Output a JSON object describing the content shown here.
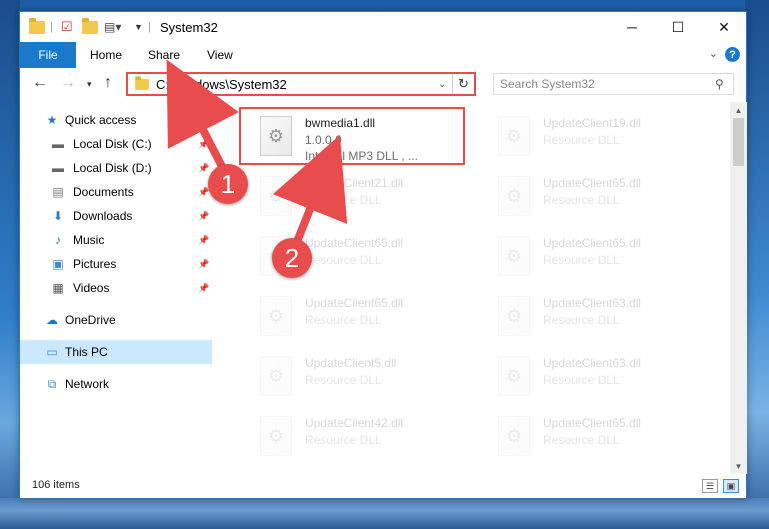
{
  "window": {
    "title": "System32",
    "controls": {
      "minimize": "─",
      "maximize": "☐",
      "close": "✕"
    }
  },
  "ribbon": {
    "file": "File",
    "tabs": [
      "Home",
      "Share",
      "View"
    ],
    "help": "?"
  },
  "address": {
    "path": "C:\\Windows\\System32",
    "search_placeholder": "Search System32"
  },
  "nav": {
    "items": [
      {
        "label": "Quick access",
        "icon": "star-icon",
        "glyph": "★",
        "color": "#2b78c5",
        "pinned": false,
        "indent": 0
      },
      {
        "label": "Local Disk (C:)",
        "icon": "drive-icon",
        "glyph": "▬",
        "color": "#666666",
        "pinned": true,
        "indent": 1
      },
      {
        "label": "Local Disk (D:)",
        "icon": "drive-icon",
        "glyph": "▬",
        "color": "#666666",
        "pinned": true,
        "indent": 1
      },
      {
        "label": "Documents",
        "icon": "documents-icon",
        "glyph": "▤",
        "color": "#777777",
        "pinned": true,
        "indent": 1
      },
      {
        "label": "Downloads",
        "icon": "downloads-icon",
        "glyph": "⬇",
        "color": "#2b78c5",
        "pinned": true,
        "indent": 1
      },
      {
        "label": "Music",
        "icon": "music-icon",
        "glyph": "♪",
        "color": "#2b78c5",
        "pinned": true,
        "indent": 1
      },
      {
        "label": "Pictures",
        "icon": "pictures-icon",
        "glyph": "▣",
        "color": "#3b8ad0",
        "pinned": true,
        "indent": 1
      },
      {
        "label": "Videos",
        "icon": "videos-icon",
        "glyph": "▦",
        "color": "#555555",
        "pinned": true,
        "indent": 1
      },
      {
        "label": "OneDrive",
        "icon": "cloud-icon",
        "glyph": "☁",
        "color": "#1979ca",
        "pinned": false,
        "indent": 0
      },
      {
        "label": "This PC",
        "icon": "computer-icon",
        "glyph": "▭",
        "color": "#3d8ee0",
        "pinned": false,
        "indent": 0,
        "selected": true
      },
      {
        "label": "Network",
        "icon": "network-icon",
        "glyph": "⧉",
        "color": "#3d8ee0",
        "pinned": false,
        "indent": 0
      }
    ]
  },
  "files": [
    {
      "name": "bwmedia1.dll",
      "line1": "1.0.0.0",
      "line2": "Internal MP3 DLL , ...",
      "faded": false
    },
    {
      "name": "UpdateClient19.dll",
      "line1": "Resource DLL",
      "line2": "",
      "faded": true
    },
    {
      "name": "UpdateClient21.dll",
      "line1": "Resource DLL",
      "line2": "",
      "faded": true
    },
    {
      "name": "UpdateClient65.dll",
      "line1": "Resource DLL",
      "line2": "",
      "faded": true
    },
    {
      "name": "UpdateClient65.dll",
      "line1": "Resource DLL",
      "line2": "",
      "faded": true
    },
    {
      "name": "UpdateClient65.dll",
      "line1": "Resource DLL",
      "line2": "",
      "faded": true
    },
    {
      "name": "UpdateClient65.dll",
      "line1": "Resource DLL",
      "line2": "",
      "faded": true
    },
    {
      "name": "UpdateClient63.dll",
      "line1": "Resource DLL",
      "line2": "",
      "faded": true
    },
    {
      "name": "UpdateClient5.dll",
      "line1": "Resource DLL",
      "line2": "",
      "faded": true
    },
    {
      "name": "UpdateClient63.dll",
      "line1": "Resource DLL",
      "line2": "",
      "faded": true
    },
    {
      "name": "UpdateClient42.dll",
      "line1": "Resource DLL",
      "line2": "",
      "faded": true
    },
    {
      "name": "UpdateClient65.dll",
      "line1": "Resource DLL",
      "line2": "",
      "faded": true
    }
  ],
  "status": {
    "items": "106 items"
  },
  "annotations": {
    "step1": "1",
    "step2": "2",
    "color": "#e84c4c"
  }
}
